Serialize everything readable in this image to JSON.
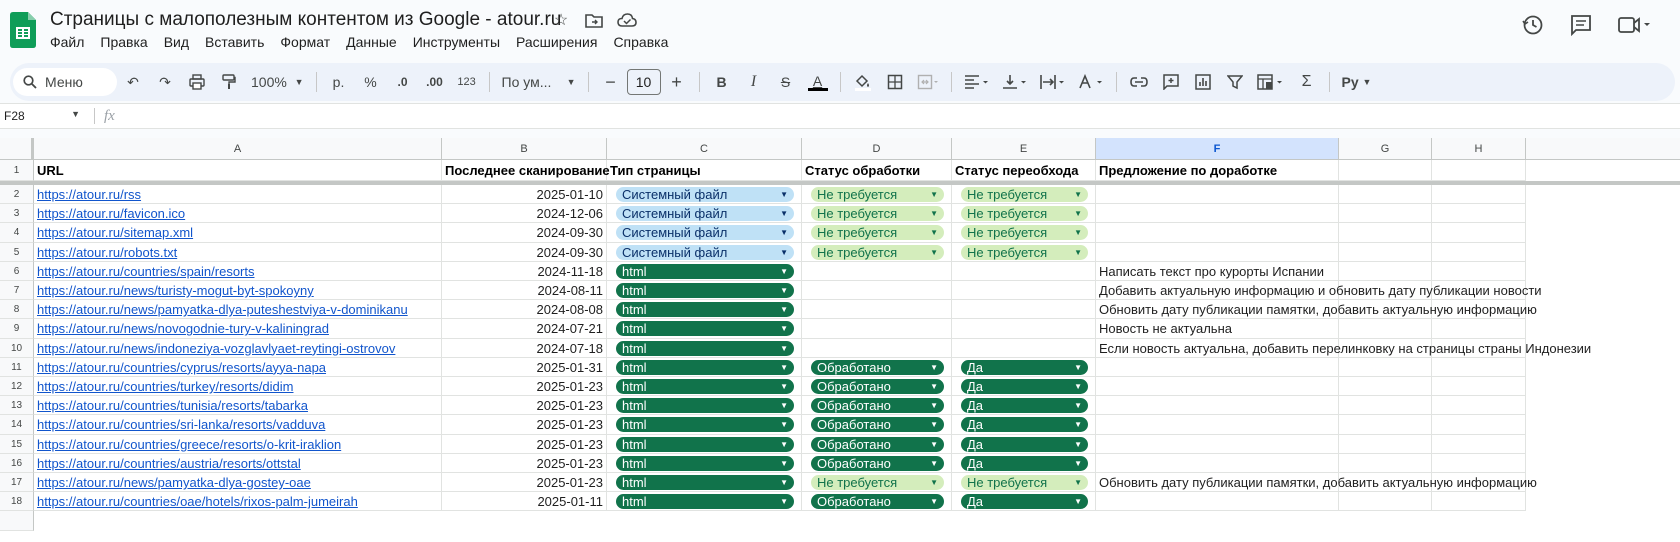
{
  "doc": {
    "title": "Страницы с малополезным контентом из Google - atour.ru",
    "menus": [
      "Файл",
      "Правка",
      "Вид",
      "Вставить",
      "Формат",
      "Данные",
      "Инструменты",
      "Расширения",
      "Справка"
    ]
  },
  "toolbar": {
    "menu_search": "Меню",
    "zoom": "100%",
    "currency": "р.",
    "percent": "%",
    "dec_decrease": ".0",
    "dec_increase": ".00",
    "number_format": "123",
    "font": "По ум...",
    "font_size": "10",
    "bold": "B",
    "italic": "I",
    "strike": "S",
    "text_color": "A",
    "sigma": "Σ",
    "input_tools": "Ру"
  },
  "formula_bar": {
    "cell_ref": "F28",
    "fx": "fx"
  },
  "columns": [
    "A",
    "B",
    "C",
    "D",
    "E",
    "F",
    "G",
    "H"
  ],
  "headers": {
    "url": "URL",
    "last_scan": "Последнее сканирование",
    "page_type": "Тип страницы",
    "process_status": "Статус обработки",
    "recrawl_status": "Статус переобхода",
    "proposal": "Предложение по доработке"
  },
  "rows": [
    {
      "n": "2",
      "url": "https://atour.ru/rss",
      "date": "2025-01-10",
      "type": "Системный файл",
      "status": "Не требуется",
      "recrawl": "Не требуется",
      "proposal": ""
    },
    {
      "n": "3",
      "url": "https://atour.ru/favicon.ico",
      "date": "2024-12-06",
      "type": "Системный файл",
      "status": "Не требуется",
      "recrawl": "Не требуется",
      "proposal": ""
    },
    {
      "n": "4",
      "url": "https://atour.ru/sitemap.xml",
      "date": "2024-09-30",
      "type": "Системный файл",
      "status": "Не требуется",
      "recrawl": "Не требуется",
      "proposal": ""
    },
    {
      "n": "5",
      "url": "https://atour.ru/robots.txt",
      "date": "2024-09-30",
      "type": "Системный файл",
      "status": "Не требуется",
      "recrawl": "Не требуется",
      "proposal": ""
    },
    {
      "n": "6",
      "url": "https://atour.ru/countries/spain/resorts",
      "date": "2024-11-18",
      "type": "html",
      "status": "",
      "recrawl": "",
      "proposal": "Написать текст про курорты Испании"
    },
    {
      "n": "7",
      "url": "https://atour.ru/news/turisty-mogut-byt-spokoyny",
      "date": "2024-08-11",
      "type": "html",
      "status": "",
      "recrawl": "",
      "proposal": "Добавить актуальную информацию и обновить дату публикации новости"
    },
    {
      "n": "8",
      "url": "https://atour.ru/news/pamyatka-dlya-puteshestviya-v-dominikanu",
      "date": "2024-08-08",
      "type": "html",
      "status": "",
      "recrawl": "",
      "proposal": "Обновить дату публикации памятки, добавить актуальную информацию"
    },
    {
      "n": "9",
      "url": "https://atour.ru/news/novogodnie-tury-v-kaliningrad",
      "date": "2024-07-21",
      "type": "html",
      "status": "",
      "recrawl": "",
      "proposal": "Новость не актуальна"
    },
    {
      "n": "10",
      "url": "https://atour.ru/news/indoneziya-vozglavlyaet-reytingi-ostrovov",
      "date": "2024-07-18",
      "type": "html",
      "status": "",
      "recrawl": "",
      "proposal": "Если новость актуальна, добавить перелинковку на страницы страны Индонезии"
    },
    {
      "n": "11",
      "url": "https://atour.ru/countries/cyprus/resorts/ayya-napa",
      "date": "2025-01-31",
      "type": "html",
      "status": "Обработано",
      "recrawl": "Да",
      "proposal": ""
    },
    {
      "n": "12",
      "url": "https://atour.ru/countries/turkey/resorts/didim",
      "date": "2025-01-23",
      "type": "html",
      "status": "Обработано",
      "recrawl": "Да",
      "proposal": ""
    },
    {
      "n": "13",
      "url": "https://atour.ru/countries/tunisia/resorts/tabarka",
      "date": "2025-01-23",
      "type": "html",
      "status": "Обработано",
      "recrawl": "Да",
      "proposal": ""
    },
    {
      "n": "14",
      "url": "https://atour.ru/countries/sri-lanka/resorts/vadduva",
      "date": "2025-01-23",
      "type": "html",
      "status": "Обработано",
      "recrawl": "Да",
      "proposal": ""
    },
    {
      "n": "15",
      "url": "https://atour.ru/countries/greece/resorts/o-krit-iraklion",
      "date": "2025-01-23",
      "type": "html",
      "status": "Обработано",
      "recrawl": "Да",
      "proposal": ""
    },
    {
      "n": "16",
      "url": "https://atour.ru/countries/austria/resorts/ottstal",
      "date": "2025-01-23",
      "type": "html",
      "status": "Обработано",
      "recrawl": "Да",
      "proposal": ""
    },
    {
      "n": "17",
      "url": "https://atour.ru/news/pamyatka-dlya-gostey-oae",
      "date": "2025-01-23",
      "type": "html",
      "status": "Не требуется",
      "recrawl": "Не требуется",
      "proposal": "Обновить дату публикации памятки, добавить актуальную информацию"
    },
    {
      "n": "18",
      "url": "https://atour.ru/countries/oae/hotels/rixos-palm-jumeirah",
      "date": "2025-01-11",
      "type": "html",
      "status": "Обработано",
      "recrawl": "Да",
      "proposal": ""
    }
  ],
  "colors": {
    "system_chip": "#bfe1f6",
    "not_required_chip": "#d4edbc",
    "dark_chip": "#11734b",
    "link": "#1155cc",
    "selected_col": "#d3e3fd"
  }
}
